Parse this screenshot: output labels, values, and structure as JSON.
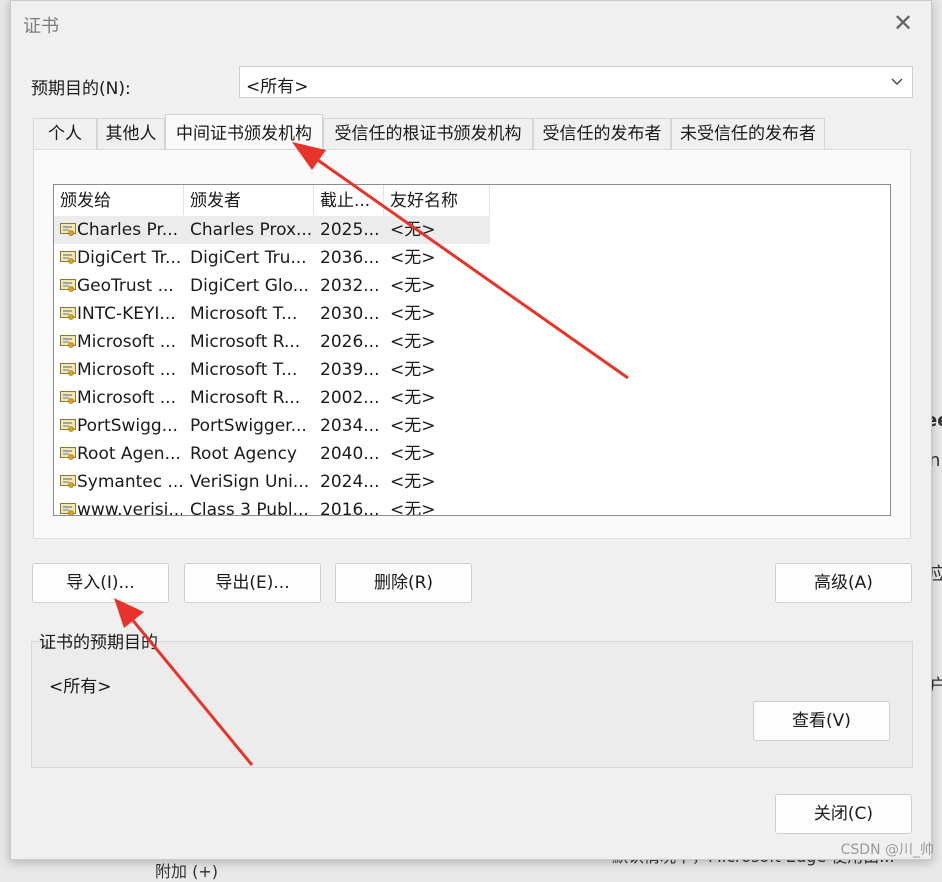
{
  "dialog": {
    "title": "证书",
    "close_icon": "close-icon",
    "intended_purpose_label": "预期目的(N):",
    "intended_purpose_value": "<所有>",
    "tabs": [
      {
        "label": "个人"
      },
      {
        "label": "其他人"
      },
      {
        "label": "中间证书颁发机构"
      },
      {
        "label": "受信任的根证书颁发机构"
      },
      {
        "label": "受信任的发布者"
      },
      {
        "label": "未受信任的发布者"
      }
    ],
    "active_tab": "中间证书颁发机构",
    "columns": [
      "颁发给",
      "颁发者",
      "截止...",
      "友好名称"
    ],
    "rows": [
      {
        "issued_to": "Charles Pr...",
        "issued_by": "Charles Prox...",
        "expires": "2025...",
        "friendly_name": "<无>"
      },
      {
        "issued_to": "DigiCert Tr...",
        "issued_by": "DigiCert Tru...",
        "expires": "2036...",
        "friendly_name": "<无>"
      },
      {
        "issued_to": "GeoTrust ...",
        "issued_by": "DigiCert Glo...",
        "expires": "2032...",
        "friendly_name": "<无>"
      },
      {
        "issued_to": "INTC-KEYI...",
        "issued_by": "Microsoft T...",
        "expires": "2030...",
        "friendly_name": "<无>"
      },
      {
        "issued_to": "Microsoft ...",
        "issued_by": "Microsoft R...",
        "expires": "2026...",
        "friendly_name": "<无>"
      },
      {
        "issued_to": "Microsoft ...",
        "issued_by": "Microsoft T...",
        "expires": "2039...",
        "friendly_name": "<无>"
      },
      {
        "issued_to": "Microsoft ...",
        "issued_by": "Microsoft R...",
        "expires": "2002...",
        "friendly_name": "<无>"
      },
      {
        "issued_to": "PortSwigg...",
        "issued_by": "PortSwigger...",
        "expires": "2034...",
        "friendly_name": "<无>"
      },
      {
        "issued_to": "Root Agen...",
        "issued_by": "Root Agency",
        "expires": "2040...",
        "friendly_name": "<无>"
      },
      {
        "issued_to": "Symantec ...",
        "issued_by": "VeriSign Uni...",
        "expires": "2024...",
        "friendly_name": "<无>"
      },
      {
        "issued_to": "www.verisi...",
        "issued_by": "Class 3 Publ...",
        "expires": "2016...",
        "friendly_name": "<无>"
      }
    ],
    "buttons": {
      "import": "导入(I)...",
      "export": "导出(E)...",
      "remove": "删除(R)",
      "advanced": "高级(A)",
      "view": "查看(V)",
      "close": "关闭(C)"
    },
    "purposes_section_label": "证书的预期目的",
    "purposes_section_value": "<所有>"
  },
  "background_fragments": [
    "ee",
    "n",
    "应",
    "户",
    "默认情况下，Microsoft Edge 使用由...",
    "附加 (+)"
  ],
  "watermark": "CSDN @川_帅",
  "annotations": {
    "arrow_color": "#e8332a"
  }
}
